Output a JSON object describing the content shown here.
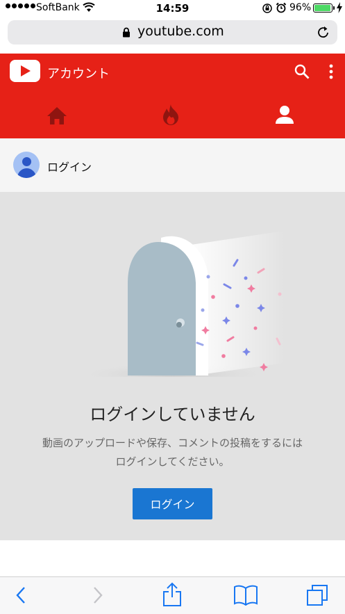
{
  "status_bar": {
    "carrier": "SoftBank",
    "time": "14:59",
    "battery_percent": "96%",
    "battery_level": 0.96
  },
  "browser": {
    "url": "youtube.com",
    "icons": [
      "lock-icon",
      "reload-icon",
      "back-icon",
      "forward-icon",
      "share-icon",
      "bookmarks-icon",
      "tabs-icon"
    ]
  },
  "header": {
    "title": "アカウント",
    "brand_color": "#e62117",
    "tabs": [
      "home-icon",
      "trending-icon",
      "account-icon"
    ]
  },
  "login_row": {
    "label": "ログイン"
  },
  "main": {
    "heading": "ログインしていません",
    "description_line1": "動画のアップロードや保存、コメントの投稿をするには",
    "description_line2": "ログインしてください。",
    "button_label": "ログイン",
    "button_color": "#1a76d2"
  }
}
